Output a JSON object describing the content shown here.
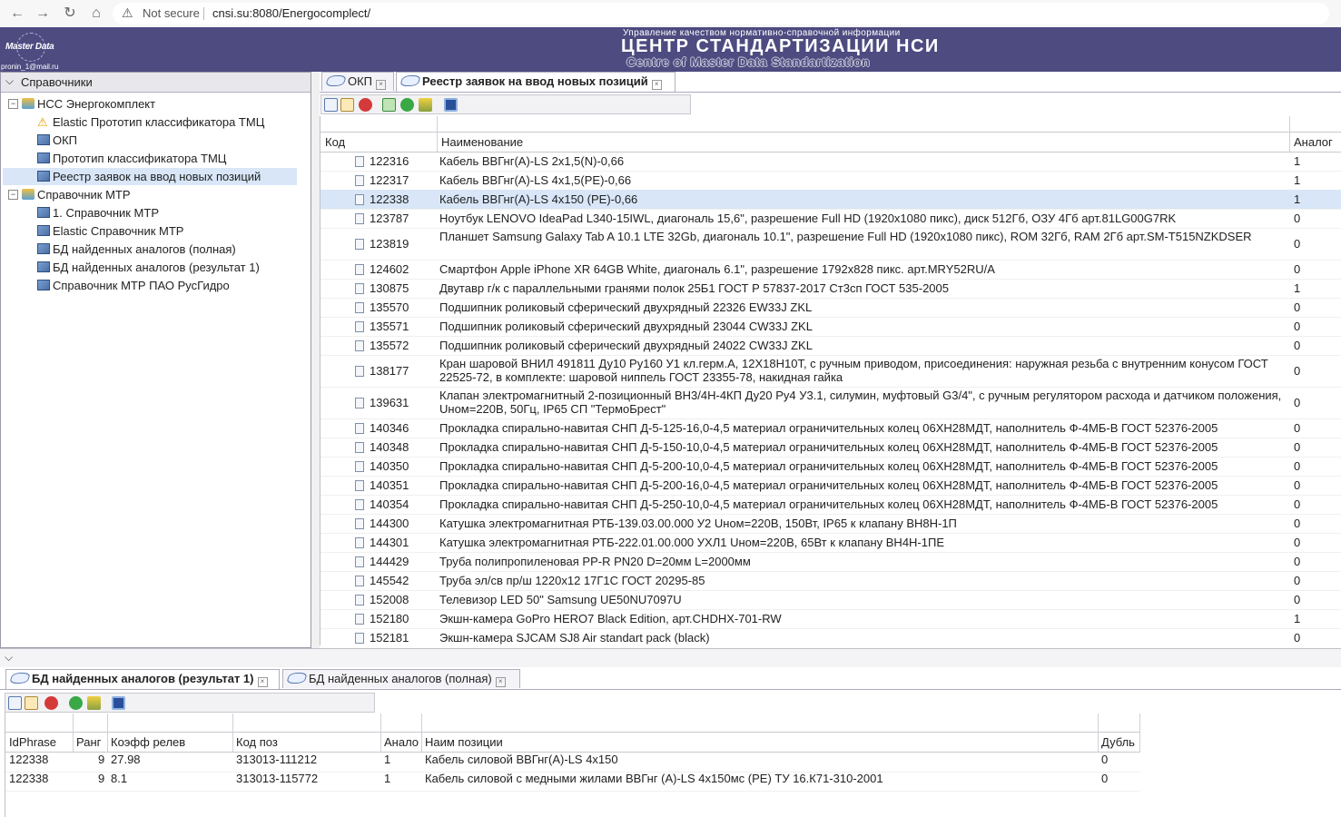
{
  "browser": {
    "security_text": "Not secure",
    "url": "cnsi.su:8080/Energocomplect/"
  },
  "banner": {
    "logo_title": "Master Data",
    "logo_email": "pronin_1@mail.ru",
    "subtitle": "Управление качеством нормативно-справочной информации",
    "title": "ЦЕНТР СТАНДАРТИЗАЦИИ НСИ",
    "title_en": "Centre of Master Data Standartization"
  },
  "left_panel": {
    "title": "Справочники",
    "tree": [
      {
        "label": "НСС Энергокомплект",
        "toggle": "−"
      },
      {
        "label": "Elastic Прототип классификатора ТМЦ"
      },
      {
        "label": "ОКП"
      },
      {
        "label": "Прототип классификатора ТМЦ"
      },
      {
        "label": "Реестр заявок на ввод новых позиций"
      },
      {
        "label": "Справочник МТР",
        "toggle": "−"
      },
      {
        "label": "1. Справочник МТР"
      },
      {
        "label": "Elastic Справочник МТР"
      },
      {
        "label": "БД найденных аналогов (полная)"
      },
      {
        "label": "БД найденных аналогов (результат 1)"
      },
      {
        "label": "Справочник МТР ПАО РусГидро"
      }
    ]
  },
  "main_tabs": [
    {
      "label": "ОКП"
    },
    {
      "label": "Реестр заявок на ввод новых позиций"
    }
  ],
  "main_grid": {
    "columns": [
      "Код",
      "Наименование",
      "Аналог"
    ],
    "rows": [
      {
        "code": "122316",
        "name": "Кабель ВВГнг(А)-LS 2x1,5(N)-0,66",
        "analog": "1"
      },
      {
        "code": "122317",
        "name": "Кабель ВВГнг(А)-LS 4x1,5(PE)-0,66",
        "analog": "1"
      },
      {
        "code": "122338",
        "name": "Кабель ВВГнг(А)-LS 4x150 (PE)-0,66",
        "analog": "1"
      },
      {
        "code": "123787",
        "name": "Ноутбук LENOVO IdeaPad L340-15IWL, диагональ 15,6\", разрешение Full HD (1920x1080 пикс), диск 512Гб, ОЗУ 4Гб арт.81LG00G7RK",
        "analog": "0"
      },
      {
        "code": "123819",
        "name": "Планшет Samsung Galaxy Tab A 10.1 LTE 32Gb, диагональ 10.1\", разрешение Full HD (1920x1080 пикс), ROM 32Гб, RAM 2Гб арт.SM-T515NZKDSER",
        "analog": "0"
      },
      {
        "code": "124602",
        "name": "Смартфон Apple iPhone XR 64GB White, диагональ 6.1\", разрешение 1792x828 пикс. арт.MRY52RU/A",
        "analog": "0"
      },
      {
        "code": "130875",
        "name": "Двутавр г/к с параллельными гранями полок 25Б1 ГОСТ Р 57837-2017 Ст3сп ГОСТ 535-2005",
        "analog": "1"
      },
      {
        "code": "135570",
        "name": "Подшипник роликовый сферический двухрядный 22326 EW33J ZKL",
        "analog": "0"
      },
      {
        "code": "135571",
        "name": "Подшипник роликовый сферический двухрядный 23044 CW33J ZKL",
        "analog": "0"
      },
      {
        "code": "135572",
        "name": "Подшипник роликовый сферический двухрядный 24022 CW33J ZKL",
        "analog": "0"
      },
      {
        "code": "138177",
        "name": "Кран шаровой ВНИЛ 491811 Ду10 Ру160 У1 кл.герм.А, 12Х18Н10Т, с ручным приводом, присоединения: наружная резьба с внутренним конусом ГОСТ 22525-72, в комплекте: шаровой ниппель ГОСТ 23355-78, накидная гайка",
        "analog": "0"
      },
      {
        "code": "139631",
        "name": "Клапан электромагнитный 2-позиционный ВН3/4Н-4КП Ду20 Ру4 У3.1, силумин, муфтовый G3/4\", с ручным регулятором расхода и датчиком положения, Uном=220В, 50Гц, IP65 СП \"ТермоБрест\"",
        "analog": "0"
      },
      {
        "code": "140346",
        "name": "Прокладка спирально-навитая СНП Д-5-125-16,0-4,5 материал ограничительных колец 06ХН28МДТ, наполнитель Ф-4МБ-В ГОСТ 52376-2005",
        "analog": "0"
      },
      {
        "code": "140348",
        "name": "Прокладка спирально-навитая СНП Д-5-150-10,0-4,5 материал ограничительных колец 06ХН28МДТ, наполнитель Ф-4МБ-В ГОСТ 52376-2005",
        "analog": "0"
      },
      {
        "code": "140350",
        "name": "Прокладка спирально-навитая СНП Д-5-200-10,0-4,5 материал ограничительных колец 06ХН28МДТ, наполнитель Ф-4МБ-В ГОСТ 52376-2005",
        "analog": "0"
      },
      {
        "code": "140351",
        "name": "Прокладка спирально-навитая СНП Д-5-200-16,0-4,5 материал ограничительных колец 06ХН28МДТ, наполнитель Ф-4МБ-В ГОСТ 52376-2005",
        "analog": "0"
      },
      {
        "code": "140354",
        "name": "Прокладка спирально-навитая СНП Д-5-250-10,0-4,5 материал ограничительных колец 06ХН28МДТ, наполнитель Ф-4МБ-В ГОСТ 52376-2005",
        "analog": "0"
      },
      {
        "code": "144300",
        "name": "Катушка электромагнитная РТБ-139.03.00.000 У2 Uном=220В, 150Вт, IP65 к клапану ВН8Н-1П",
        "analog": "0"
      },
      {
        "code": "144301",
        "name": "Катушка электромагнитная РТБ-222.01.00.000 УХЛ1 Uном=220В, 65Вт к клапану ВН4Н-1ПЕ",
        "analog": "0"
      },
      {
        "code": "144429",
        "name": "Труба полипропиленовая PP-R PN20 D=20мм L=2000мм",
        "analog": "0"
      },
      {
        "code": "145542",
        "name": "Труба эл/св пр/ш 1220x12 17Г1С ГОСТ 20295-85",
        "analog": "0"
      },
      {
        "code": "152008",
        "name": "Телевизор LED 50\" Samsung UE50NU7097U",
        "analog": "0"
      },
      {
        "code": "152180",
        "name": "Экшн-камера GoPro HERO7 Black Edition, арт.CHDHX-701-RW",
        "analog": "1"
      },
      {
        "code": "152181",
        "name": "Экшн-камера SJCAM SJ8 Air standart pack (black)",
        "analog": "0"
      }
    ]
  },
  "bottom_tabs": [
    {
      "label": "БД найденных аналогов (результат 1)"
    },
    {
      "label": "БД найденных аналогов (полная)"
    }
  ],
  "bottom_grid": {
    "columns": [
      "IdPhrase",
      "Ранг",
      "Коэфф релев",
      "Код поз",
      "Анало",
      "Наим позиции",
      "Дубль"
    ],
    "rows": [
      {
        "id": "122338",
        "rank": "9",
        "coef": "27.98",
        "code": "313013-111212",
        "analog": "1",
        "name": "Кабель силовой ВВГнг(А)-LS 4x150",
        "dup": "0"
      },
      {
        "id": "122338",
        "rank": "9",
        "coef": "8.1",
        "code": "313013-115772",
        "analog": "1",
        "name": "Кабель силовой с медными жилами ВВГнг (А)-LS 4x150мс (PE) ТУ 16.К71-310-2001",
        "dup": "0"
      }
    ]
  },
  "colors": {
    "banner": "#4d4b80",
    "selection": "#d8e6f8"
  }
}
